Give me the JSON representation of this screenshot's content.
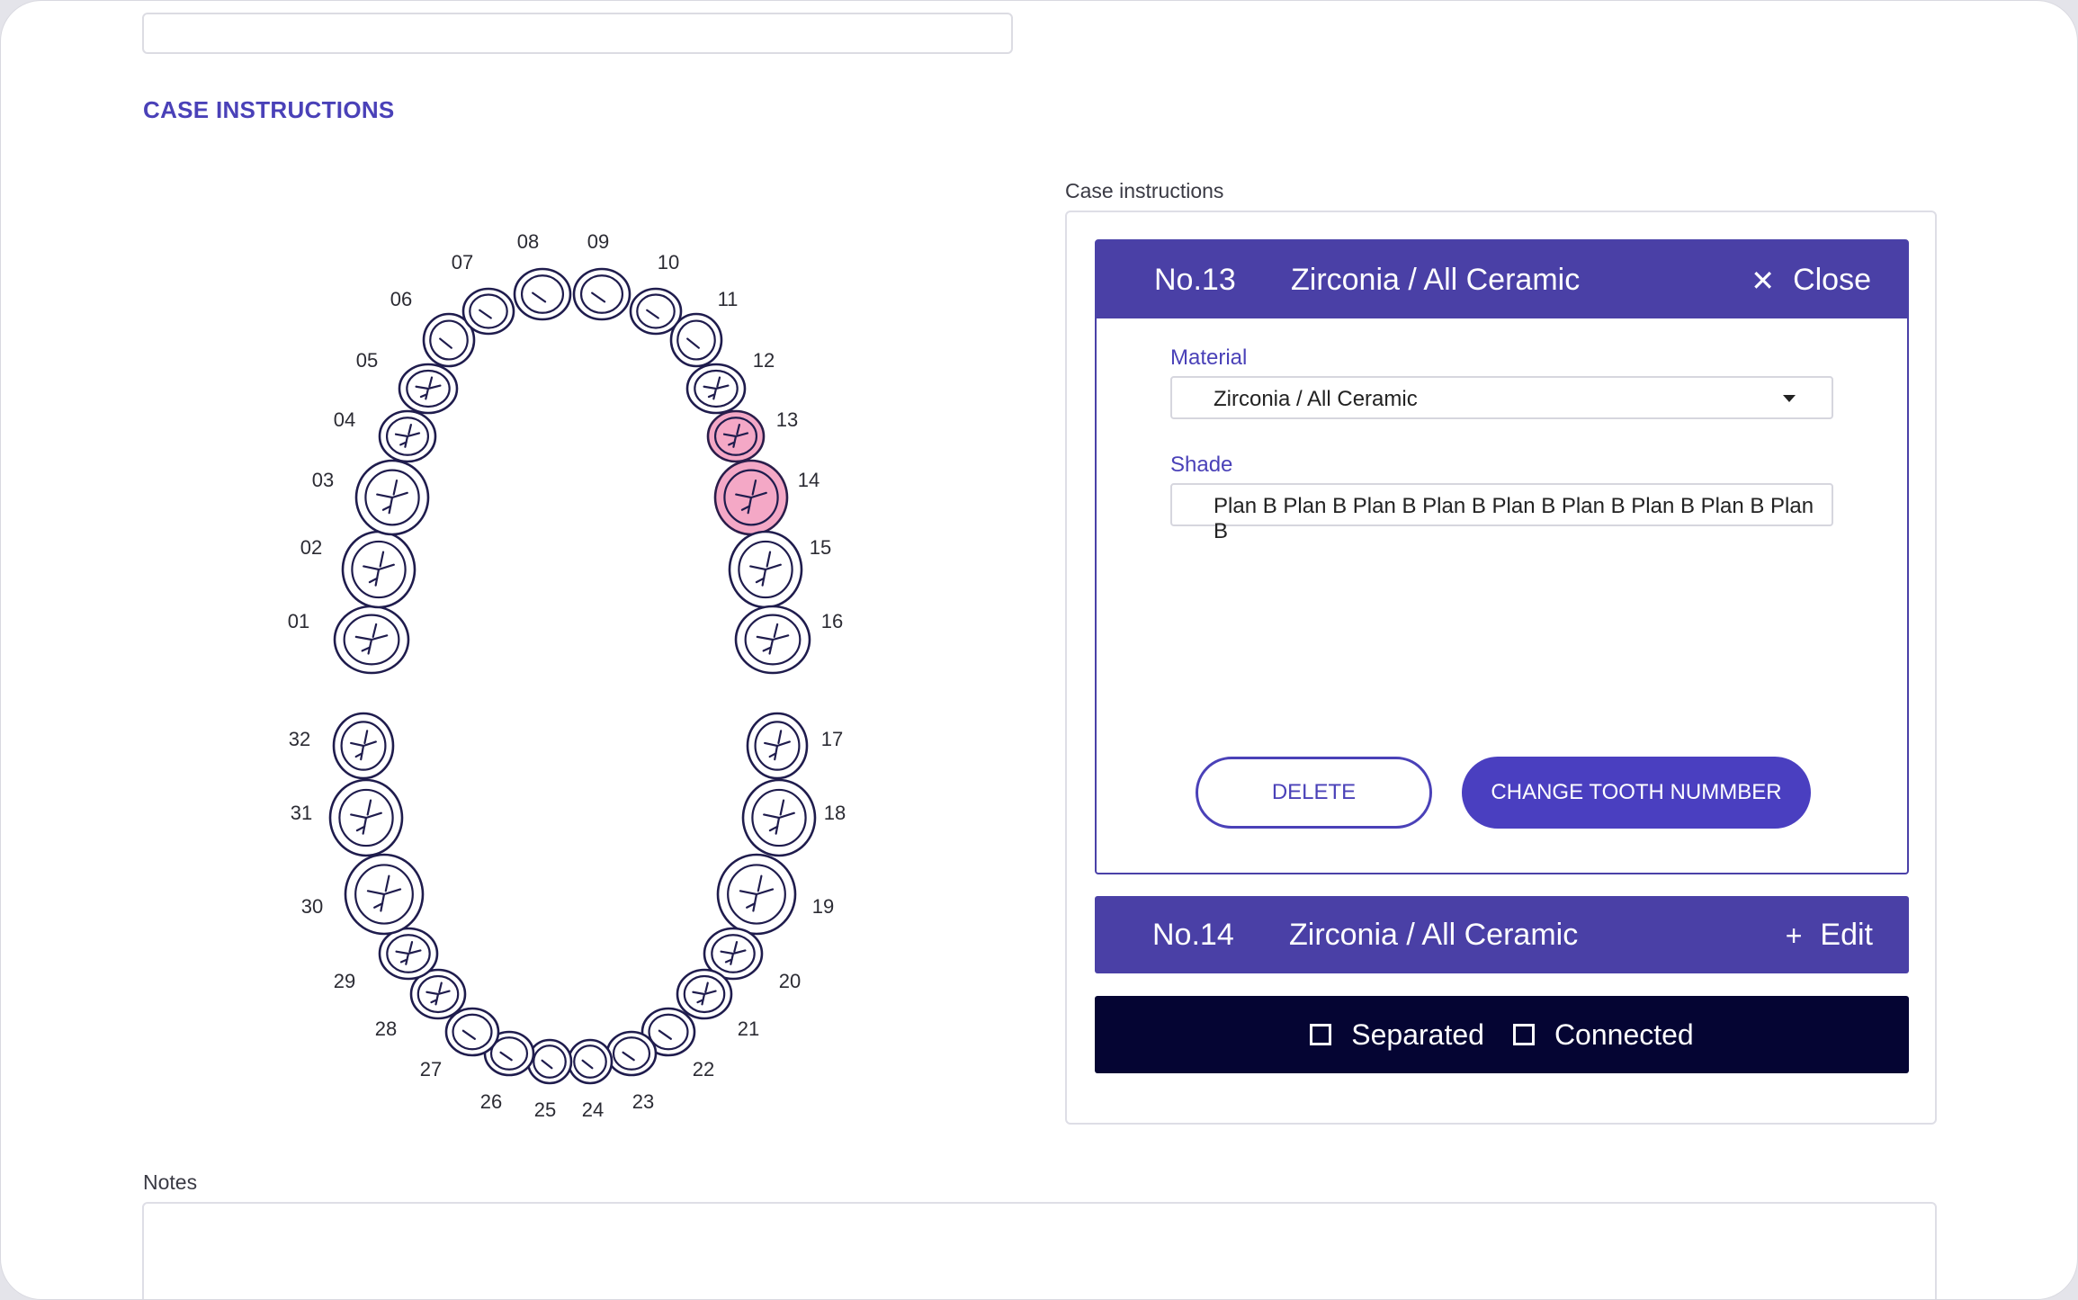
{
  "section_title": "CASE INSTRUCTIONS",
  "tooth_chart": {
    "selected": [
      "13",
      "14"
    ],
    "selected_color": "#f4a8c6",
    "numbers": [
      "01",
      "02",
      "03",
      "04",
      "05",
      "06",
      "07",
      "08",
      "09",
      "10",
      "11",
      "12",
      "13",
      "14",
      "15",
      "16",
      "17",
      "18",
      "19",
      "20",
      "21",
      "22",
      "23",
      "24",
      "25",
      "26",
      "27",
      "28",
      "29",
      "30",
      "31",
      "32"
    ]
  },
  "case_panel": {
    "label": "Case instructions",
    "active_card": {
      "number": "No.13",
      "material": "Zirconia / All Ceramic",
      "action_label": "Close",
      "action_icon": "close-icon",
      "material_label": "Material",
      "material_value": "Zirconia / All Ceramic",
      "shade_label": "Shade",
      "shade_value": "Plan B Plan B Plan B Plan B Plan B Plan B Plan B Plan B Plan B",
      "delete_label": "DELETE",
      "change_label": "CHANGE TOOTH NUMMBER"
    },
    "collapsed_card": {
      "number": "No.14",
      "material": "Zirconia / All Ceramic",
      "action_label": "Edit",
      "action_icon": "plus-icon"
    },
    "separated_label": "Separated",
    "connected_label": "Connected",
    "separated_checked": false,
    "connected_checked": false
  },
  "notes": {
    "label": "Notes",
    "value": ""
  },
  "colors": {
    "accent": "#4a41b8",
    "header_bg": "#4a40a6",
    "dark_bar": "#050533"
  }
}
